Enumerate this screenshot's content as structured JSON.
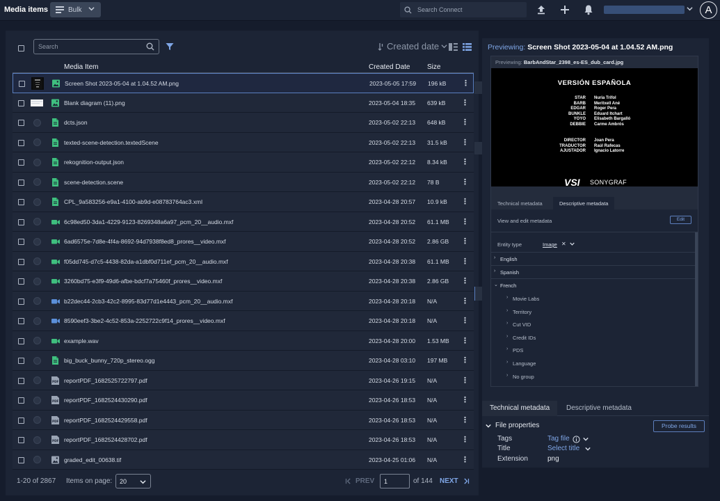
{
  "topbar": {
    "app_title": "Media items",
    "bulk_label": "Bulk",
    "search_placeholder": "Search Connect",
    "user_initial": "A"
  },
  "toolbar": {
    "search_placeholder": "Search",
    "sort_label": "Created date"
  },
  "columns": {
    "media_item": "Media Item",
    "created_date": "Created Date",
    "size": "Size"
  },
  "rows": [
    {
      "name": "Screen Shot 2023-05-04 at 1.04.52 AM.png",
      "date": "2023-05-05 17:59",
      "size": "196 kB",
      "type": "image",
      "thumb": "screenshot",
      "selected": true
    },
    {
      "name": "Blank diagram (11).png",
      "date": "2023-05-04 18:35",
      "size": "639 kB",
      "type": "image",
      "thumb": "diagram",
      "selected": false
    },
    {
      "name": "dcts.json",
      "date": "2023-05-02 22:13",
      "size": "648 kB",
      "type": "doc",
      "thumb": "none",
      "selected": false
    },
    {
      "name": "texted-scene-detection.textedScene",
      "date": "2023-05-02 22:13",
      "size": "31.5 kB",
      "type": "doc",
      "thumb": "none",
      "selected": false
    },
    {
      "name": "rekognition-output.json",
      "date": "2023-05-02 22:12",
      "size": "8.34 kB",
      "type": "doc",
      "thumb": "none",
      "selected": false
    },
    {
      "name": "scene-detection.scene",
      "date": "2023-05-02 22:12",
      "size": "78 B",
      "type": "doc",
      "thumb": "none",
      "selected": false
    },
    {
      "name": "CPL_9a583256-e9a1-4100-ab9d-e08783764ac3.xml",
      "date": "2023-04-28 20:57",
      "size": "10.9 kB",
      "type": "doc",
      "thumb": "none",
      "selected": false
    },
    {
      "name": "6c98ed50-3da1-4229-9123-8269348a6a97_pcm_20__audio.mxf",
      "date": "2023-04-28 20:52",
      "size": "61.1 MB",
      "type": "video-green",
      "thumb": "none",
      "selected": false
    },
    {
      "name": "6ad6575e-7d8e-4f4a-8692-94d7938f8ed8_prores__video.mxf",
      "date": "2023-04-28 20:52",
      "size": "2.86 GB",
      "type": "video-green",
      "thumb": "none",
      "selected": false
    },
    {
      "name": "f05dd745-d7c5-4438-82da-a1dbf0d711ef_pcm_20__audio.mxf",
      "date": "2023-04-28 20:38",
      "size": "61.1 MB",
      "type": "video-green",
      "thumb": "none",
      "selected": false
    },
    {
      "name": "3260bd75-e3f9-49d6-afbe-bdcf7a75460f_prores__video.mxf",
      "date": "2023-04-28 20:38",
      "size": "2.86 GB",
      "type": "video-green",
      "thumb": "none",
      "selected": false
    },
    {
      "name": "b22dec44-2cb3-42c2-8995-83d77d1e4443_pcm_20__audio.mxf",
      "date": "2023-04-28 20:18",
      "size": "N/A",
      "type": "video-blue",
      "thumb": "none",
      "selected": false
    },
    {
      "name": "8590eef3-3be2-4c52-853a-2252722c9f14_prores__video.mxf",
      "date": "2023-04-28 20:18",
      "size": "N/A",
      "type": "video-blue",
      "thumb": "none",
      "selected": false
    },
    {
      "name": "example.wav",
      "date": "2023-04-28 20:00",
      "size": "1.53 MB",
      "type": "video-green",
      "thumb": "none",
      "selected": false
    },
    {
      "name": "big_buck_bunny_720p_stereo.ogg",
      "date": "2023-04-28 03:10",
      "size": "197 MB",
      "type": "doc",
      "thumb": "none",
      "selected": false
    },
    {
      "name": "reportPDF_1682525722797.pdf",
      "date": "2023-04-26 19:15",
      "size": "N/A",
      "type": "pdf",
      "thumb": "none",
      "selected": false
    },
    {
      "name": "reportPDF_1682524430290.pdf",
      "date": "2023-04-26 18:53",
      "size": "N/A",
      "type": "pdf",
      "thumb": "none",
      "selected": false
    },
    {
      "name": "reportPDF_1682524429558.pdf",
      "date": "2023-04-26 18:53",
      "size": "N/A",
      "type": "pdf",
      "thumb": "none",
      "selected": false
    },
    {
      "name": "reportPDF_1682524428702.pdf",
      "date": "2023-04-26 18:53",
      "size": "N/A",
      "type": "pdf",
      "thumb": "none",
      "selected": false
    },
    {
      "name": "graded_edit_00638.tif",
      "date": "2023-04-25 01:06",
      "size": "N/A",
      "type": "image-grey",
      "thumb": "none",
      "selected": false
    }
  ],
  "pagination": {
    "range": "1-20 of 2867",
    "items_label": "Items on page:",
    "items_value": "20",
    "prev": "PREV",
    "page": "1",
    "of_pages": "of 144",
    "next": "NEXT"
  },
  "preview": {
    "label": "Previewing:",
    "file": "Screen Shot 2023-05-04 at 1.04.52 AM.png",
    "inner_label": "Previewing:",
    "inner_file": "BarbAndStar_2398_es-ES_dub_card.jpg",
    "card": {
      "title": "VERSIÓN ESPAÑOLA",
      "cast": [
        {
          "role": "STAR",
          "name": "Nuria Trifol"
        },
        {
          "role": "BARB",
          "name": "Meritxell Ané"
        },
        {
          "role": "EDGAR",
          "name": "Roger Pera"
        },
        {
          "role": "BUNKLE",
          "name": "Eduard Itchart"
        },
        {
          "role": "YOYO",
          "name": "Elisabeth Bargalló"
        },
        {
          "role": "DEBBIE",
          "name": "Carme Ambrós"
        }
      ],
      "crew": [
        {
          "role": "DIRECTOR",
          "name": "Joan Pera"
        },
        {
          "role": "TRADUCTOR",
          "name": "Raúl Rafecas"
        },
        {
          "role": "AJUSTADOR",
          "name": "Ignacio Latorre"
        }
      ],
      "logo_mark": "VSI",
      "logo_text": "SONYGRAF"
    },
    "inner_tabs": [
      "Technical metadata",
      "Descriptive metadata"
    ],
    "view_edit": "View and edit metadata",
    "edit": "Edit",
    "entity_type_label": "Entity type",
    "entity_type_value": "Image",
    "languages": [
      "English",
      "Spanish",
      "French"
    ],
    "french_children": [
      "Movie Labs",
      "Territory",
      "Cut VID",
      "Credit IDs",
      "PDS",
      "Language",
      "No group"
    ]
  },
  "metadata": {
    "tabs": [
      "Technical metadata",
      "Descriptive metadata"
    ],
    "section": "File properties",
    "probe": "Probe results",
    "fields": [
      {
        "key": "Tags",
        "value": "Tag file",
        "kind": "link"
      },
      {
        "key": "Title",
        "value": "Select title",
        "kind": "link"
      },
      {
        "key": "Extension",
        "value": "png",
        "kind": "plain"
      }
    ]
  },
  "colors": {
    "accent": "#7fa6e6",
    "panel": "#1c2435",
    "background": "#151c2c",
    "file_green": "#3fbf7f",
    "file_blue": "#5b8fd9"
  }
}
